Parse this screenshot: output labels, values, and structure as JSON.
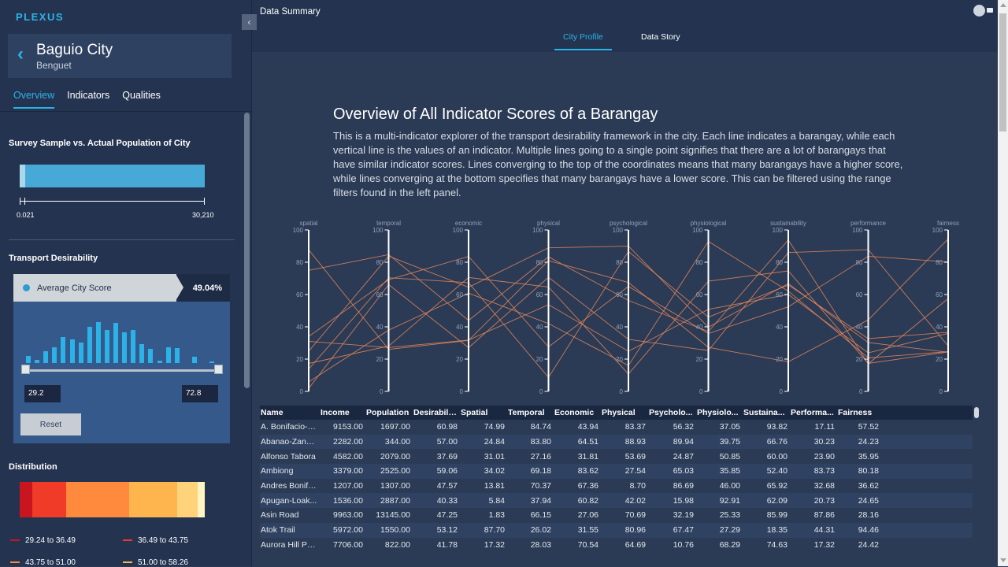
{
  "app": {
    "brand": "PLEXUS",
    "page_title": "Data Summary"
  },
  "city": {
    "name": "Baguio City",
    "province": "Benguet"
  },
  "side_tabs": [
    {
      "label": "Overview",
      "active": true
    },
    {
      "label": "Indicators",
      "active": false
    },
    {
      "label": "Qualities",
      "active": false
    }
  ],
  "survey": {
    "title": "Survey Sample vs. Actual Population of City",
    "sample_value": "0.021",
    "population_value": "30,210",
    "axis_min_label": "0.021",
    "axis_max_label": "30,210",
    "sample_fraction": 0.03
  },
  "transport": {
    "title": "Transport Desirability",
    "score_label": "Average City Score",
    "score_value": "49.04%",
    "histogram": [
      0.08,
      0.04,
      0.14,
      0.18,
      0.3,
      0.27,
      0.24,
      0.42,
      0.47,
      0.38,
      0.46,
      0.35,
      0.38,
      0.22,
      0.16,
      0.03,
      0.18,
      0.17,
      0.0,
      0.07,
      0.0,
      0.02
    ],
    "range_min": "29.2",
    "range_max": "72.8",
    "reset_label": "Reset"
  },
  "distribution": {
    "title": "Distribution",
    "segments": [
      {
        "color": "#c8151f",
        "weight": 7
      },
      {
        "color": "#ef3b28",
        "weight": 18
      },
      {
        "color": "#ff8a3d",
        "weight": 34
      },
      {
        "color": "#ffb54d",
        "weight": 26
      },
      {
        "color": "#ffd37a",
        "weight": 11
      },
      {
        "color": "#fff4c2",
        "weight": 4
      }
    ],
    "legend": [
      {
        "label": "29.24 to 36.49",
        "color": "#c8151f"
      },
      {
        "label": "36.49 to 43.75",
        "color": "#ef3b28"
      },
      {
        "label": "43.75 to 51.00",
        "color": "#ff8a3d"
      },
      {
        "label": "51.00 to 58.26",
        "color": "#ffb54d"
      }
    ]
  },
  "main_tabs": [
    {
      "label": "City Profile",
      "active": true
    },
    {
      "label": "Data Story",
      "active": false
    }
  ],
  "overview": {
    "title": "Overview of All Indicator Scores of a Barangay",
    "description": "This is a multi-indicator explorer of the transport desirability framework in the city. Each line indicates a barangay, while each vertical line is the values of an indicator. Multiple lines going to a single point signifies that there are a lot of barangays that have similar indicator scores. Lines converging to the top of the coordinates means that many barangays have a higher score, while lines converging at the bottom specifies that many barangays have a lower score. This can be filtered using the range filters found in the left panel."
  },
  "chart_data": {
    "type": "parallel-coordinates",
    "axes": [
      "spatial",
      "temporal",
      "economic",
      "physical",
      "psychological",
      "physiological",
      "sustainability",
      "performance",
      "fairness"
    ],
    "ylim": [
      0,
      100
    ],
    "ticks": [
      0,
      20,
      40,
      60,
      80,
      100
    ],
    "line_color": "#e8875a",
    "series": [
      {
        "name": "A. Bonifacio-C...",
        "values": [
          74.99,
          84.74,
          43.94,
          83.37,
          56.32,
          37.05,
          93.82,
          17.11,
          57.52
        ]
      },
      {
        "name": "Abanao-Zand...",
        "values": [
          24.84,
          83.8,
          64.51,
          88.93,
          89.94,
          39.75,
          66.76,
          30.23,
          24.23
        ]
      },
      {
        "name": "Alfonso Tabora",
        "values": [
          31.01,
          27.16,
          31.81,
          53.69,
          24.87,
          50.85,
          60.0,
          23.9,
          35.95
        ]
      },
      {
        "name": "Ambiong",
        "values": [
          34.02,
          69.18,
          83.62,
          27.54,
          65.03,
          35.85,
          52.4,
          83.73,
          80.18
        ]
      },
      {
        "name": "Andres Bonifa...",
        "values": [
          13.81,
          70.37,
          67.36,
          8.7,
          86.69,
          46.0,
          65.92,
          32.68,
          36.62
        ]
      },
      {
        "name": "Apugan-Loak...",
        "values": [
          5.84,
          37.94,
          60.82,
          42.02,
          15.98,
          92.91,
          62.09,
          20.73,
          24.65
        ]
      },
      {
        "name": "Asin Road",
        "values": [
          1.83,
          66.15,
          27.06,
          70.69,
          32.19,
          25.33,
          85.99,
          87.86,
          28.16
        ]
      },
      {
        "name": "Atok Trail",
        "values": [
          87.7,
          26.02,
          31.55,
          80.96,
          67.47,
          27.29,
          18.35,
          44.31,
          94.46
        ]
      },
      {
        "name": "Aurora Hill Pro...",
        "values": [
          17.32,
          28.03,
          70.54,
          64.69,
          10.76,
          68.29,
          74.63,
          17.32,
          24.42
        ]
      }
    ]
  },
  "table": {
    "columns": [
      "Name",
      "Income",
      "Population",
      "Desirabili...",
      "Spatial",
      "Temporal",
      "Economic",
      "Physical",
      "Psycholo...",
      "Physiolo...",
      "Sustaina...",
      "Performa...",
      "Fairness"
    ],
    "rows": [
      [
        "A. Bonifacio-C...",
        "9153.00",
        "1697.00",
        "60.98",
        "74.99",
        "84.74",
        "43.94",
        "83.37",
        "56.32",
        "37.05",
        "93.82",
        "17.11",
        "57.52"
      ],
      [
        "Abanao-Zand...",
        "2282.00",
        "344.00",
        "57.00",
        "24.84",
        "83.80",
        "64.51",
        "88.93",
        "89.94",
        "39.75",
        "66.76",
        "30.23",
        "24.23"
      ],
      [
        "Alfonso Tabora",
        "4582.00",
        "2079.00",
        "37.69",
        "31.01",
        "27.16",
        "31.81",
        "53.69",
        "24.87",
        "50.85",
        "60.00",
        "23.90",
        "35.95"
      ],
      [
        "Ambiong",
        "3379.00",
        "2525.00",
        "59.06",
        "34.02",
        "69.18",
        "83.62",
        "27.54",
        "65.03",
        "35.85",
        "52.40",
        "83.73",
        "80.18"
      ],
      [
        "Andres Bonifa...",
        "1207.00",
        "1307.00",
        "47.57",
        "13.81",
        "70.37",
        "67.36",
        "8.70",
        "86.69",
        "46.00",
        "65.92",
        "32.68",
        "36.62"
      ],
      [
        "Apugan-Loak...",
        "1536.00",
        "2887.00",
        "40.33",
        "5.84",
        "37.94",
        "60.82",
        "42.02",
        "15.98",
        "92.91",
        "62.09",
        "20.73",
        "24.65"
      ],
      [
        "Asin Road",
        "9963.00",
        "13145.00",
        "47.25",
        "1.83",
        "66.15",
        "27.06",
        "70.69",
        "32.19",
        "25.33",
        "85.99",
        "87.86",
        "28.16"
      ],
      [
        "Atok Trail",
        "5972.00",
        "1550.00",
        "53.12",
        "87.70",
        "26.02",
        "31.55",
        "80.96",
        "67.47",
        "27.29",
        "18.35",
        "44.31",
        "94.46"
      ],
      [
        "Aurora Hill Pro...",
        "7706.00",
        "822.00",
        "41.78",
        "17.32",
        "28.03",
        "70.54",
        "64.69",
        "10.76",
        "68.29",
        "74.63",
        "17.32",
        "24.42"
      ]
    ]
  }
}
